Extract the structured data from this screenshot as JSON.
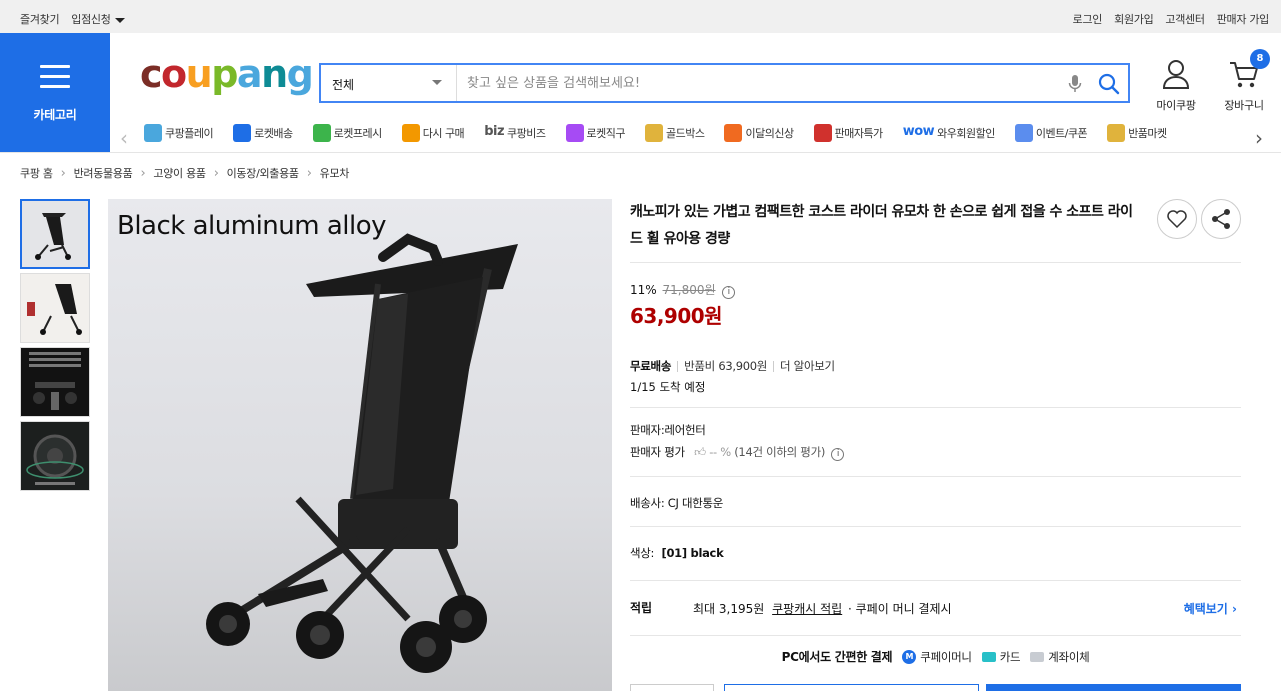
{
  "topbar": {
    "left": [
      "즐겨찾기",
      "입점신청"
    ],
    "right": [
      "로그인",
      "회원가입",
      "고객센터",
      "판매자 가입"
    ]
  },
  "category": {
    "label": "카테고리"
  },
  "logo": {
    "letters": [
      "c",
      "o",
      "u",
      "p",
      "a",
      "n",
      "g"
    ],
    "colors": [
      "#7b2d26",
      "#c2272d",
      "#f89f21",
      "#7ab929",
      "#4aa7dd",
      "#0e8b95",
      "#4aa7dd"
    ]
  },
  "search": {
    "category": "전체",
    "placeholder": "찾고 싶은 상품을 검색해보세요!"
  },
  "header_icons": {
    "mycoupang": "마이쿠팡",
    "cart": "장바구니",
    "cart_count": "8"
  },
  "quick_menu": [
    {
      "label": "쿠팡플레이",
      "color": "#4aa7dd"
    },
    {
      "label": "로켓배송",
      "color": "#1e6ee6"
    },
    {
      "label": "로켓프레시",
      "color": "#3cb44b"
    },
    {
      "label": "다시 구매",
      "color": "#f39800"
    },
    {
      "label": "쿠팡비즈",
      "color": "#555555",
      "prefix": "biz"
    },
    {
      "label": "로켓직구",
      "color": "#a64bf4"
    },
    {
      "label": "골드박스",
      "color": "#e0b33c"
    },
    {
      "label": "이달의신상",
      "color": "#f06a20"
    },
    {
      "label": "판매자특가",
      "color": "#d0312d"
    },
    {
      "label": "와우회원할인",
      "color": "#1e6ee6",
      "prefix": "wow"
    },
    {
      "label": "이벤트/쿠폰",
      "color": "#5b8dee"
    },
    {
      "label": "반품마켓",
      "color": "#e0b33c"
    }
  ],
  "breadcrumb": [
    "쿠팡 홈",
    "반려동물용품",
    "고양이 용품",
    "이동장/외출용품",
    "유모차"
  ],
  "image_caption": "Black aluminum alloy",
  "product": {
    "title": "캐노피가 있는 가볍고 컴팩트한 코스트 라이더 유모차 한 손으로 쉽게 접을 수 소프트 라이드 휠 유아용 경량",
    "discount_rate": "11%",
    "original_price": "71,800원",
    "price": "63,900원",
    "shipping_label": "무료배송",
    "return_fee": "반품비 63,900원",
    "more": "더 알아보기",
    "eta": "1/15 도착 예정",
    "seller": "판매자:레어헌터",
    "seller_rating_label": "판매자 평가",
    "seller_rating_value": "-- %",
    "seller_rating_note": "(14건 이하의 평가)",
    "courier": "배송사:  CJ 대한통운",
    "color_label": "색상:",
    "color_value": "[01] black",
    "reward_label": "적립",
    "reward_max": "최대 3,195원",
    "reward_link": "쿠팡캐시 적립",
    "reward_note": "· 쿠페이 머니 결제시",
    "benefit_link": "혜택보기",
    "pay_title": "PC에서도 간편한 결제",
    "pay_methods": [
      "쿠페이머니",
      "카드",
      "계좌이체"
    ]
  },
  "colors": {
    "brand_blue": "#1e6ee6",
    "price_red": "#ae0000"
  }
}
